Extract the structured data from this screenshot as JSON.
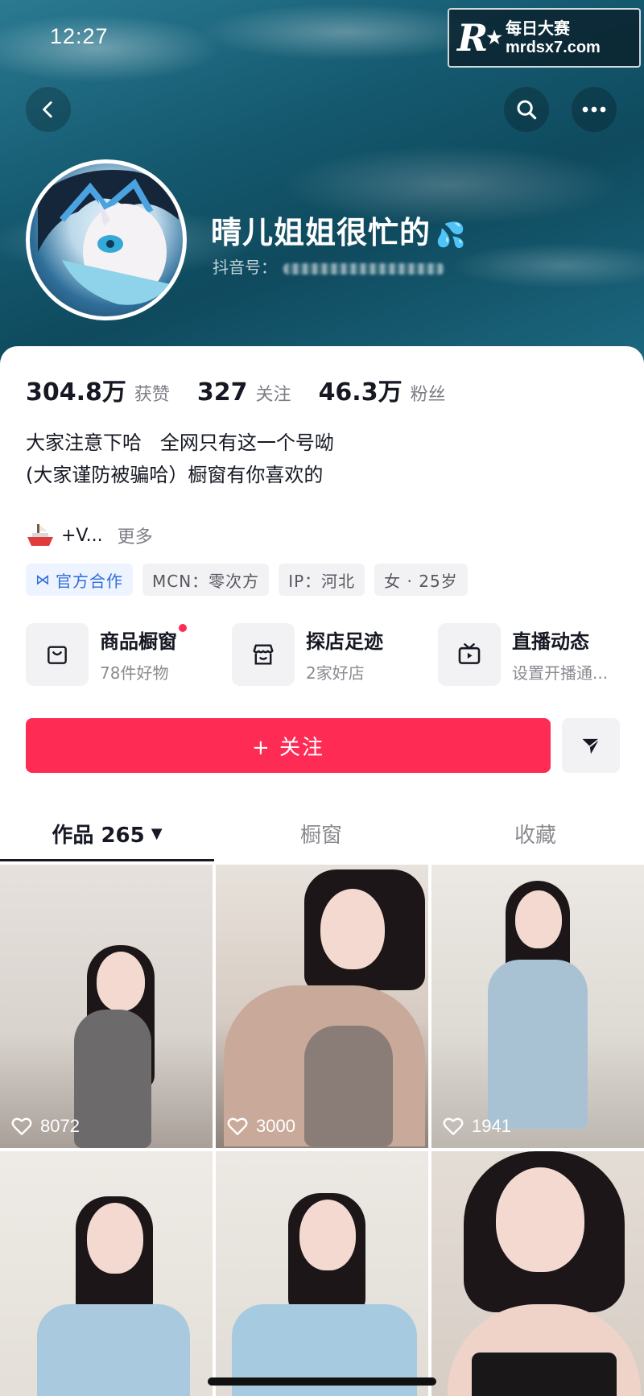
{
  "status_bar": {
    "time": "12:27"
  },
  "watermark": {
    "line1": "每日大赛",
    "line2": "mrdsx7.com",
    "logo_letter": "R"
  },
  "profile": {
    "nickname": "晴儿姐姐很忙的",
    "nickname_emoji": "💦",
    "douyin_id_label": "抖音号："
  },
  "stats": [
    {
      "value": "304.8万",
      "label": "获赞"
    },
    {
      "value": "327",
      "label": "关注"
    },
    {
      "value": "46.3万",
      "label": "粉丝"
    }
  ],
  "bio": {
    "line1": "大家注意下哈   全网只有这一个号呦",
    "line2": "(大家谨防被骗哈）橱窗有你喜欢的"
  },
  "extra": {
    "text": "+V...",
    "more": "更多"
  },
  "tags": [
    {
      "label": "官方合作",
      "official": true
    },
    {
      "label": "MCN：零次方"
    },
    {
      "label": "IP：河北"
    },
    {
      "label": "女 · 25岁"
    }
  ],
  "features": [
    {
      "title": "商品橱窗",
      "sub": "78件好物",
      "icon": "bag-icon",
      "dot": true
    },
    {
      "title": "探店足迹",
      "sub": "2家好店",
      "icon": "store-icon"
    },
    {
      "title": "直播动态",
      "sub": "设置开播通...",
      "icon": "tv-icon"
    }
  ],
  "follow_button": "+ 关注",
  "tabs": [
    {
      "label": "作品 265",
      "active": true
    },
    {
      "label": "橱窗"
    },
    {
      "label": "收藏"
    }
  ],
  "videos": [
    {
      "likes": "8072"
    },
    {
      "likes": "3000"
    },
    {
      "likes": "1941"
    },
    {
      "likes": ""
    },
    {
      "likes": ""
    },
    {
      "likes": ""
    }
  ],
  "colors": {
    "accent": "#fe2c55",
    "text": "#161823",
    "muted": "#8a8b91",
    "official": "#2f6bd9"
  }
}
